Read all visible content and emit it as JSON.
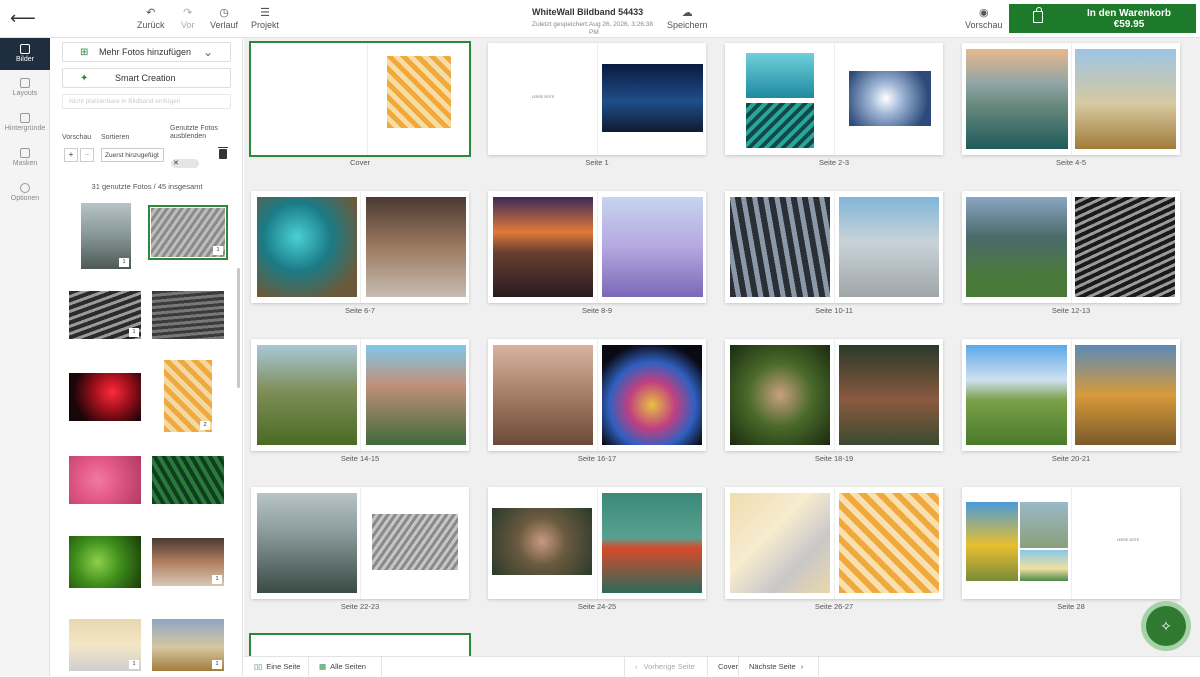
{
  "topbar": {
    "undo_label": "Zurück",
    "redo_label": "Vor",
    "history_label": "Verlauf",
    "project_label": "Projekt",
    "title": "WhiteWall Bildband 54433",
    "saved_label": "Zuletzt gespeichert:",
    "saved_value": "Aug 26, 2026, 3:26:38 PM",
    "save_label": "Speichern",
    "preview_label": "Vorschau",
    "cart_label": "In den Warenkorb",
    "cart_price": "€59.95"
  },
  "rail": {
    "items": [
      {
        "label": "Bilder",
        "active": true
      },
      {
        "label": "Layouts"
      },
      {
        "label": "Hintergründe"
      },
      {
        "label": "Masken"
      },
      {
        "label": "Optionen"
      }
    ]
  },
  "panel": {
    "add_photos": "Mehr Fotos hinzufügen",
    "smart_creation": "Smart Creation",
    "search_placeholder": "Nicht platzierbare in Bildband einfügen",
    "preview_label": "Vorschau",
    "sort_label": "Sortieren",
    "hide_label": "Genutzte Fotos ausblenden",
    "sort_value": "Zuerst hinzugefügt",
    "toggle_value": "✕",
    "count": "31 genutzte Fotos / 45 insgesamt",
    "thumbs": [
      {
        "badge": "1"
      },
      {
        "badge": "1"
      },
      {
        "badge": "1"
      },
      {
        "badge": ""
      },
      {
        "badge": ""
      },
      {
        "badge": "2"
      },
      {
        "badge": ""
      },
      {
        "badge": ""
      },
      {
        "badge": ""
      },
      {
        "badge": "1"
      },
      {
        "badge": "1"
      },
      {
        "badge": "1"
      }
    ]
  },
  "spreads": [
    {
      "caption": "Cover"
    },
    {
      "caption": "Seite 1",
      "page_title": "LEERE SEITE"
    },
    {
      "caption": "Seite 2-3"
    },
    {
      "caption": "Seite 4-5"
    },
    {
      "caption": "Seite 6-7"
    },
    {
      "caption": "Seite 8-9"
    },
    {
      "caption": "Seite 10-11"
    },
    {
      "caption": "Seite 12-13"
    },
    {
      "caption": "Seite 14-15"
    },
    {
      "caption": "Seite 16-17"
    },
    {
      "caption": "Seite 18-19"
    },
    {
      "caption": "Seite 20-21"
    },
    {
      "caption": "Seite 22-23"
    },
    {
      "caption": "Seite 24-25"
    },
    {
      "caption": "Seite 26-27"
    },
    {
      "caption": "Seite 28",
      "page_title": "LEERE SEITE"
    }
  ],
  "bottombar": {
    "single_page": "Eine Seite",
    "all_pages": "Alle Seiten",
    "prev": "Vorherige Seite",
    "cover": "Cover",
    "next": "Nächste Seite"
  },
  "colors": {
    "accent": "#1d7a2b",
    "rail_active": "#1e2e3e"
  }
}
